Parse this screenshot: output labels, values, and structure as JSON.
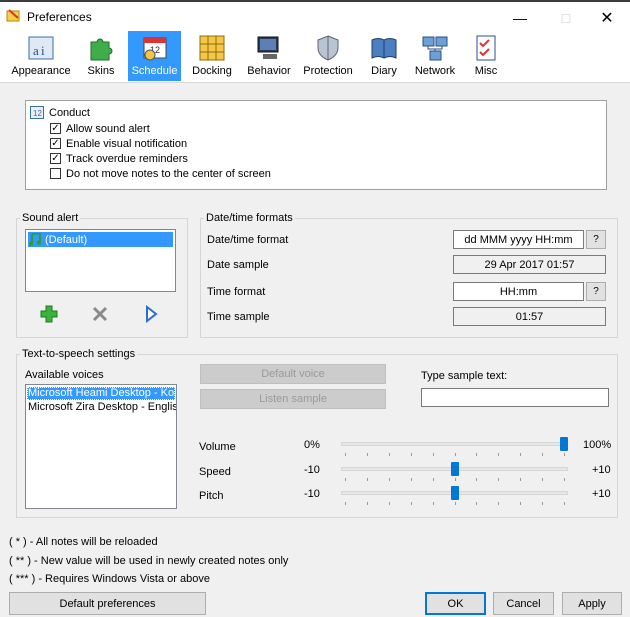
{
  "window": {
    "title": "Preferences"
  },
  "toolbar": {
    "items": [
      {
        "label": "Appearance"
      },
      {
        "label": "Skins"
      },
      {
        "label": "Schedule"
      },
      {
        "label": "Docking"
      },
      {
        "label": "Behavior"
      },
      {
        "label": "Protection"
      },
      {
        "label": "Diary"
      },
      {
        "label": "Network"
      },
      {
        "label": "Misc"
      }
    ],
    "active": "Schedule"
  },
  "conduct": {
    "title": "Conduct",
    "options": [
      {
        "label": "Allow sound alert",
        "checked": true
      },
      {
        "label": "Enable visual notification",
        "checked": true
      },
      {
        "label": "Track overdue reminders",
        "checked": true
      },
      {
        "label": "Do not move notes to the center of screen",
        "checked": false
      }
    ]
  },
  "sound_alert": {
    "title": "Sound alert",
    "items": [
      "(Default)"
    ]
  },
  "datetime": {
    "title": "Date/time formats",
    "format_label": "Date/time format",
    "format_value": "dd MMM yyyy HH:mm",
    "sample_label": "Date sample",
    "sample_value": "29 Apr 2017 01:57",
    "time_format_label": "Time format",
    "time_format_value": "HH:mm",
    "time_sample_label": "Time sample",
    "time_sample_value": "01:57",
    "help": "?"
  },
  "tts": {
    "title": "Text-to-speech settings",
    "voices_label": "Available voices",
    "voices": [
      "Microsoft Heami Desktop - Korea",
      "Microsoft Zira Desktop - English"
    ],
    "default_voice": "Default voice",
    "listen_sample": "Listen sample",
    "sample_label": "Type sample text:",
    "sample_value": "",
    "volume": {
      "label": "Volume",
      "min": "0%",
      "max": "100%",
      "value": 1.0
    },
    "speed": {
      "label": "Speed",
      "min": "-10",
      "max": "+10",
      "value": 0.5
    },
    "pitch": {
      "label": "Pitch",
      "min": "-10",
      "max": "+10",
      "value": 0.5
    }
  },
  "notes": [
    "( * ) - All notes will be reloaded",
    "( ** ) - New value will be used in newly created notes only",
    "( *** ) - Requires Windows Vista or above"
  ],
  "buttons": {
    "defaults": "Default preferences",
    "ok": "OK",
    "cancel": "Cancel",
    "apply": "Apply"
  },
  "colors": {
    "accent": "#3399ff",
    "focus": "#0078d7",
    "add": "#2e9e2e",
    "delete": "#7a7a7a"
  }
}
